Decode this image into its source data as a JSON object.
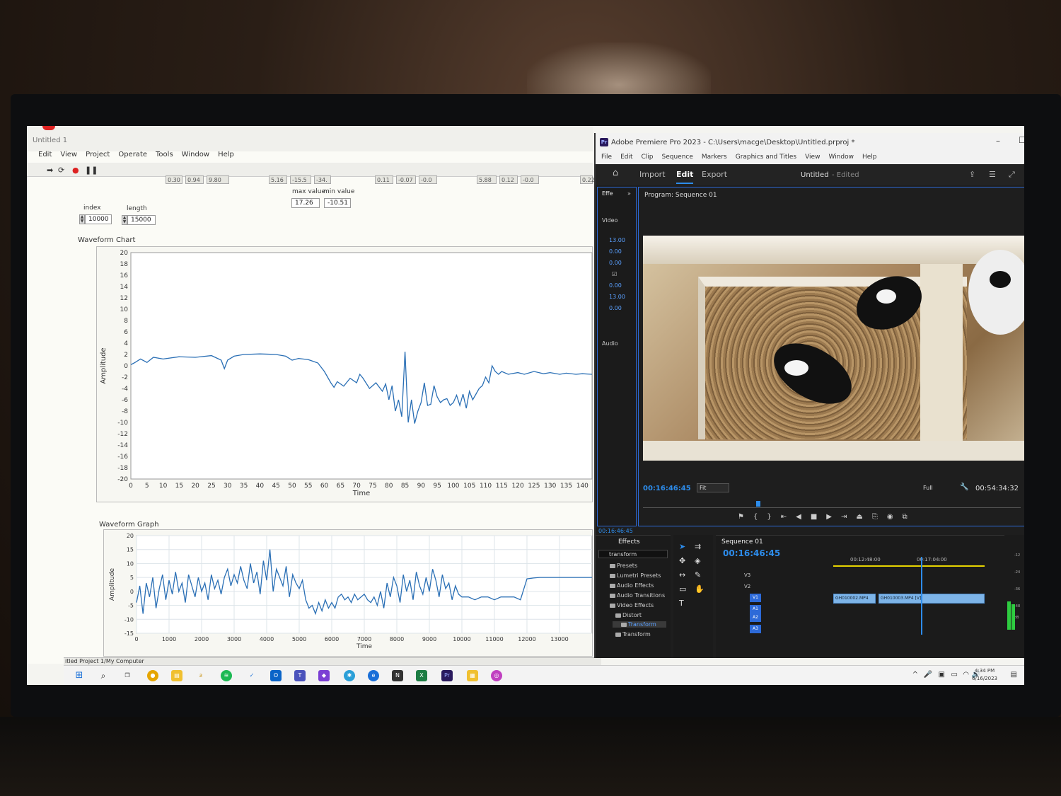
{
  "labview": {
    "window_title": "Untitled 1",
    "menu": [
      "Edit",
      "View",
      "Project",
      "Operate",
      "Tools",
      "Window",
      "Help"
    ],
    "indicators": [
      "0.30",
      "0.94",
      "9.80",
      "5.16",
      "-15.5",
      "-34.",
      "0.11",
      "-0.07",
      "-0.0",
      "5.88",
      "0.12",
      "-0.0",
      "0.22"
    ],
    "max_label": "max value",
    "min_label": "min value",
    "max_value": "17.26",
    "min_value": "-10.51",
    "index_label": "index",
    "index_value": "10000",
    "length_label": "length",
    "length_value": "15000",
    "status": "itled Project 1/My Computer"
  },
  "chart_data": [
    {
      "type": "line",
      "title": "Waveform Chart",
      "xlabel": "Time",
      "ylabel": "Amplitude",
      "xlim": [
        0,
        143
      ],
      "ylim": [
        -20,
        20
      ],
      "xticks": [
        0,
        5,
        10,
        15,
        20,
        25,
        30,
        35,
        40,
        45,
        50,
        55,
        60,
        65,
        70,
        75,
        80,
        85,
        90,
        95,
        100,
        105,
        110,
        115,
        120,
        125,
        130,
        135,
        140
      ],
      "yticks": [
        20,
        18,
        16,
        14,
        12,
        10,
        8,
        6,
        4,
        2,
        0,
        -2,
        -4,
        -6,
        -8,
        -10,
        -12,
        -14,
        -16,
        -18,
        -20
      ],
      "x": [
        0,
        1,
        3,
        5,
        7,
        10,
        15,
        20,
        25,
        28,
        29,
        30,
        32,
        35,
        40,
        45,
        48,
        50,
        52,
        55,
        58,
        60,
        62,
        63,
        64,
        66,
        68,
        70,
        71,
        72,
        74,
        76,
        78,
        79,
        80,
        81,
        82,
        83,
        84,
        85,
        86,
        87,
        88,
        89,
        90,
        91,
        92,
        93,
        94,
        95,
        96,
        97,
        98,
        99,
        100,
        101,
        102,
        103,
        104,
        105,
        106,
        107,
        108,
        109,
        110,
        111,
        112,
        113,
        114,
        115,
        117,
        120,
        122,
        125,
        128,
        130,
        133,
        135,
        138,
        140,
        143
      ],
      "y": [
        0.2,
        0.5,
        1.2,
        0.6,
        1.5,
        1.2,
        1.6,
        1.5,
        1.8,
        1.0,
        -0.5,
        1.0,
        1.7,
        2.0,
        2.1,
        2.0,
        1.7,
        1.0,
        1.3,
        1.1,
        0.5,
        -1.0,
        -3.0,
        -3.8,
        -2.8,
        -3.6,
        -2.2,
        -3.0,
        -1.5,
        -2.2,
        -4.0,
        -3.0,
        -4.5,
        -3.2,
        -6.0,
        -3.5,
        -8.0,
        -6.0,
        -9.0,
        2.5,
        -10.0,
        -6.0,
        -10.2,
        -8.0,
        -6.5,
        -3.0,
        -7.0,
        -6.8,
        -3.5,
        -5.5,
        -6.5,
        -6.0,
        -5.8,
        -7.0,
        -6.5,
        -5.2,
        -7.0,
        -5.0,
        -7.5,
        -4.5,
        -6.0,
        -5.0,
        -4.0,
        -3.5,
        -2.0,
        -3.0,
        0.0,
        -1.0,
        -1.5,
        -1.0,
        -1.5,
        -1.2,
        -1.5,
        -1.0,
        -1.4,
        -1.2,
        -1.5,
        -1.3,
        -1.5,
        -1.4,
        -1.5
      ]
    },
    {
      "type": "line",
      "title": "Waveform Graph",
      "xlabel": "Time",
      "ylabel": "Amplitude",
      "xlim": [
        0,
        14000
      ],
      "ylim": [
        -15,
        20
      ],
      "xticks": [
        0,
        1000,
        2000,
        3000,
        4000,
        5000,
        6000,
        7000,
        8000,
        9000,
        10000,
        11000,
        12000,
        13000
      ],
      "yticks": [
        20,
        15,
        10,
        5,
        0,
        -5,
        -10,
        -15
      ],
      "x": [
        0,
        100,
        200,
        300,
        400,
        500,
        600,
        700,
        800,
        900,
        1000,
        1100,
        1200,
        1300,
        1400,
        1500,
        1600,
        1700,
        1800,
        1900,
        2000,
        2100,
        2200,
        2300,
        2400,
        2500,
        2600,
        2700,
        2800,
        2900,
        3000,
        3100,
        3200,
        3300,
        3400,
        3500,
        3600,
        3700,
        3800,
        3900,
        4000,
        4100,
        4200,
        4300,
        4400,
        4500,
        4600,
        4700,
        4800,
        4900,
        5000,
        5100,
        5200,
        5300,
        5400,
        5500,
        5600,
        5700,
        5800,
        5900,
        6000,
        6100,
        6200,
        6300,
        6400,
        6500,
        6600,
        6700,
        6800,
        6900,
        7000,
        7100,
        7200,
        7300,
        7400,
        7500,
        7600,
        7700,
        7800,
        7900,
        8000,
        8100,
        8200,
        8300,
        8400,
        8500,
        8600,
        8700,
        8800,
        8900,
        9000,
        9100,
        9200,
        9300,
        9400,
        9500,
        9600,
        9700,
        9800,
        9900,
        10000,
        10200,
        10400,
        10600,
        10800,
        11000,
        11200,
        11400,
        11600,
        11800,
        12000,
        12200,
        12400,
        12600,
        12800,
        13000,
        13500,
        14000
      ],
      "y": [
        -4,
        2,
        -8,
        3,
        -2,
        5,
        -6,
        1,
        6,
        -3,
        4,
        -1,
        7,
        0,
        3,
        -4,
        6,
        2,
        -2,
        5,
        0,
        3,
        -3,
        6,
        1,
        4,
        -1,
        5,
        8,
        2,
        6,
        3,
        9,
        4,
        1,
        10,
        3,
        7,
        -1,
        11,
        4,
        15,
        0,
        8,
        5,
        2,
        9,
        -2,
        6,
        3,
        1,
        4,
        -3,
        -6,
        -5,
        -8,
        -4,
        -7,
        -3,
        -6,
        -4,
        -6,
        -2,
        -1,
        -3,
        -2,
        -4,
        -1,
        -3,
        -2,
        -1,
        -3,
        -4,
        -2,
        -5,
        0,
        -6,
        3,
        -2,
        5,
        2,
        -4,
        6,
        0,
        4,
        -3,
        7,
        2,
        -1,
        5,
        0,
        8,
        4,
        -2,
        6,
        1,
        3,
        -3,
        2,
        -1,
        -2,
        -2,
        -3,
        -2,
        -2,
        -3,
        -2,
        -2,
        -2,
        -3,
        4.5,
        4.8,
        5,
        5,
        5,
        5,
        5,
        5
      ]
    }
  ],
  "premiere": {
    "window_title": "Adobe Premiere Pro 2023 - C:\\Users\\macge\\Desktop\\Untitled.prproj *",
    "logo": "Pr",
    "menu": [
      "File",
      "Edit",
      "Clip",
      "Sequence",
      "Markers",
      "Graphics and Titles",
      "View",
      "Window",
      "Help"
    ],
    "tabs": [
      "Import",
      "Edit",
      "Export"
    ],
    "project_title": "Untitled",
    "project_status": "- Edited",
    "left_panel": {
      "tab": "Effe",
      "video_label": "Video",
      "audio_label": "Audio",
      "values": [
        "13.00",
        "0.00",
        "0.00",
        "0.00",
        "13.00",
        "0.00"
      ]
    },
    "monitor": {
      "title": "Program: Sequence 01",
      "timecode": "00:16:46:45",
      "fit": "Fit",
      "quality": "Full",
      "duration": "00:54:34:32"
    },
    "left_timecode": "00:16:46:45",
    "effects_panel": {
      "tab": "Effects",
      "search": "transform",
      "items": [
        "Presets",
        "Lumetri Presets",
        "Audio Effects",
        "Audio Transitions",
        "Video Effects",
        "Distort",
        "Transform",
        "Transform"
      ]
    },
    "timeline": {
      "title": "Sequence 01",
      "timecode": "00:16:46:45",
      "ruler": [
        "00:12:48:00",
        "00:17:04:00"
      ],
      "video_tracks": [
        "V3",
        "V2",
        "V1"
      ],
      "audio_tracks": [
        "A1",
        "A2",
        "A3"
      ],
      "clips": [
        "GH010002.MP4 [V]",
        "GH010003.MP4 [V]"
      ]
    },
    "meter_labels": [
      "-12",
      "-24",
      "-36",
      "-48",
      "dB"
    ]
  },
  "taskbar": {
    "time": "4:34 PM",
    "date": "6/16/2023"
  },
  "colors": {
    "accent": "#2d8ceb",
    "waveform": "#2a6fb5"
  }
}
